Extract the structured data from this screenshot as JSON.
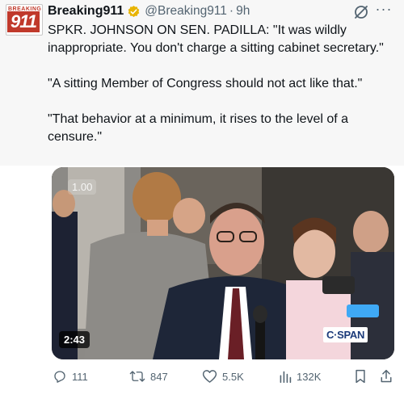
{
  "tweet": {
    "avatar": {
      "top_text": "BREAKING",
      "number": "911"
    },
    "author_name": "Breaking911",
    "handle": "@Breaking911",
    "separator": "·",
    "time": "9h",
    "paragraphs": [
      "SPKR. JOHNSON ON SEN. PADILLA: \"It was wildly inappropriate. You don't charge a sitting cabinet secretary.\"",
      "\"A sitting Member of Congress should not act like that.\"",
      "\"That behavior at a minimum, it rises to the level of a censure.\""
    ],
    "more_label": "···",
    "verified_color": "#e8b400"
  },
  "video": {
    "speed_label": "1.00",
    "duration": "2:43",
    "network_logo": "C·SPAN"
  },
  "actions": {
    "replies": "111",
    "reposts": "847",
    "likes": "5.5K",
    "views": "132K"
  },
  "colors": {
    "muted": "#536471",
    "text": "#0f1419",
    "brand_red": "#c0392b"
  }
}
